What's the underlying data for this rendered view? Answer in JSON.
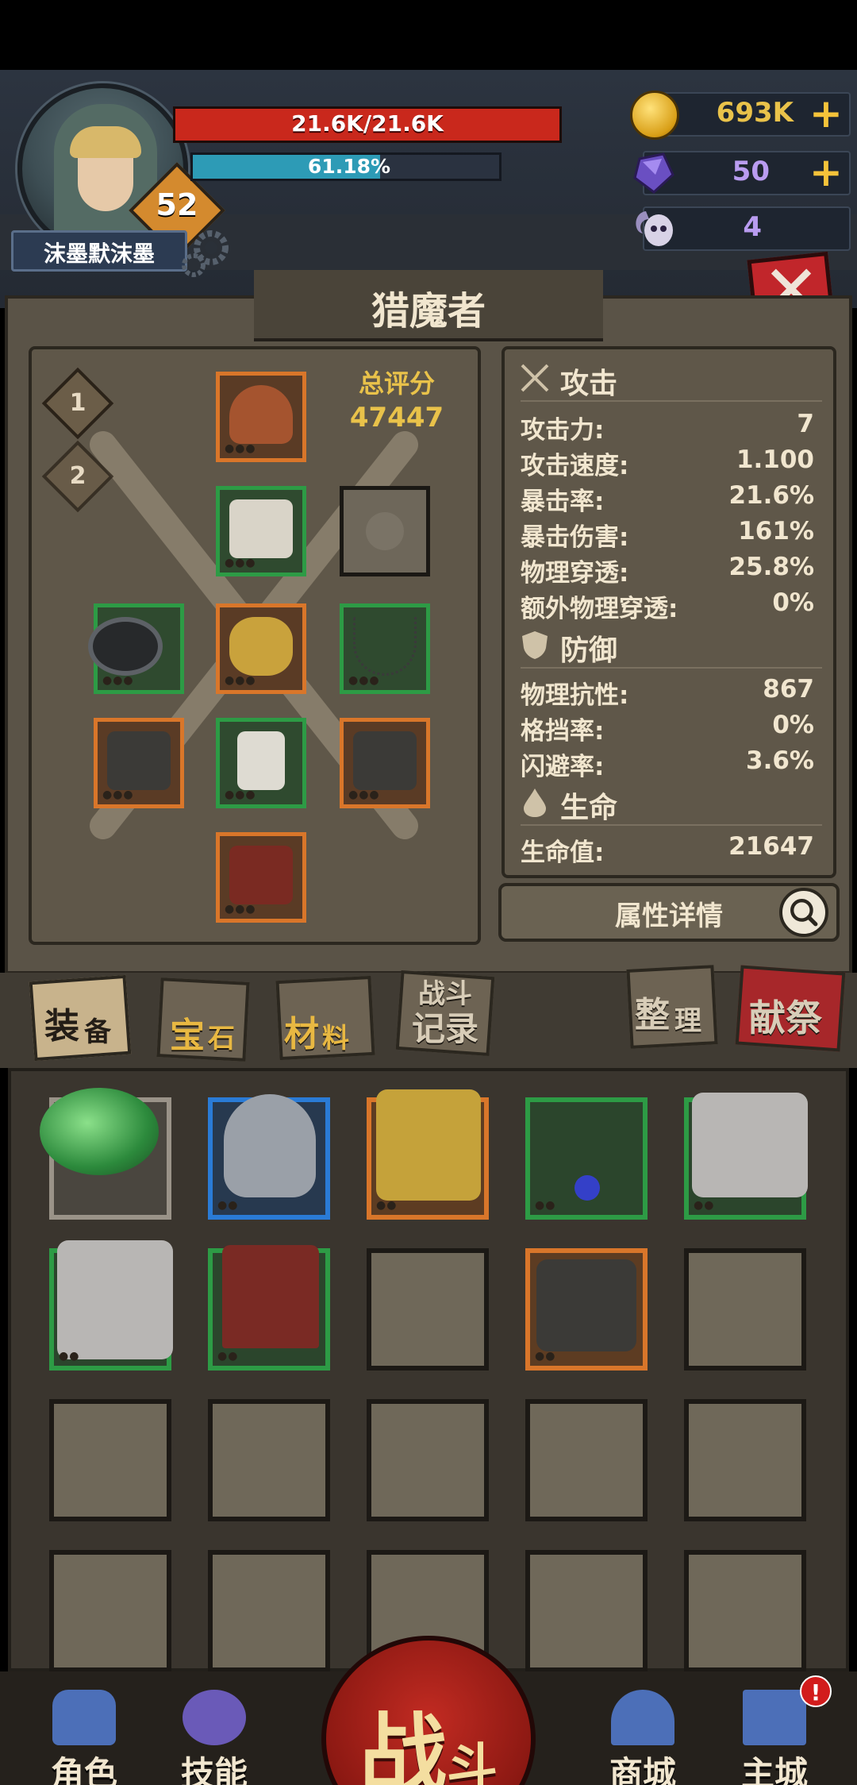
{
  "player": {
    "name": "沫墨默沫墨",
    "level": "52",
    "hp_text": "21.6K/21.6K",
    "hp_fraction": 1.0,
    "xp_text": "61.18%",
    "xp_fraction": 0.6118
  },
  "currencies": {
    "gold": "693K",
    "gems": "50",
    "keys": "4",
    "plus": "+"
  },
  "panel": {
    "title": "猎魔者",
    "score_label": "总评分",
    "score_value": "47447",
    "set_1": "1",
    "set_2": "2"
  },
  "stats": {
    "attack_section": "攻击",
    "defense_section": "防御",
    "life_section": "生命",
    "rows": [
      {
        "label": "攻击力:",
        "value": "7"
      },
      {
        "label": "攻击速度:",
        "value": "1.100"
      },
      {
        "label": "暴击率:",
        "value": "21.6%"
      },
      {
        "label": "暴击伤害:",
        "value": "161%"
      },
      {
        "label": "物理穿透:",
        "value": "25.8%"
      },
      {
        "label": "额外物理穿透:",
        "value": "0%"
      },
      {
        "label": "物理抗性:",
        "value": "867"
      },
      {
        "label": "格挡率:",
        "value": "0%"
      },
      {
        "label": "闪避率:",
        "value": "3.6%"
      },
      {
        "label": "生命值:",
        "value": "21647"
      }
    ],
    "detail_button": "属性详情"
  },
  "tabs": {
    "equipment": [
      "装",
      "备"
    ],
    "gems": [
      "宝",
      "石"
    ],
    "materials": [
      "材",
      "料"
    ],
    "battle_log": [
      "战斗",
      "记录"
    ],
    "sort": [
      "整",
      "理"
    ],
    "sacrifice": "献祭"
  },
  "nav": {
    "character": "角色",
    "skills": "技能",
    "battle": [
      "战",
      "斗"
    ],
    "shop": "商城",
    "city": "主城",
    "alert": "!"
  },
  "colors": {
    "rarity_orange": "#d9762a",
    "rarity_green": "#2d9b45",
    "rarity_blue": "#2a7bd6",
    "hp_red": "#c9281c",
    "xp_cyan": "#2d9bb6",
    "gold": "#e9c24a"
  }
}
